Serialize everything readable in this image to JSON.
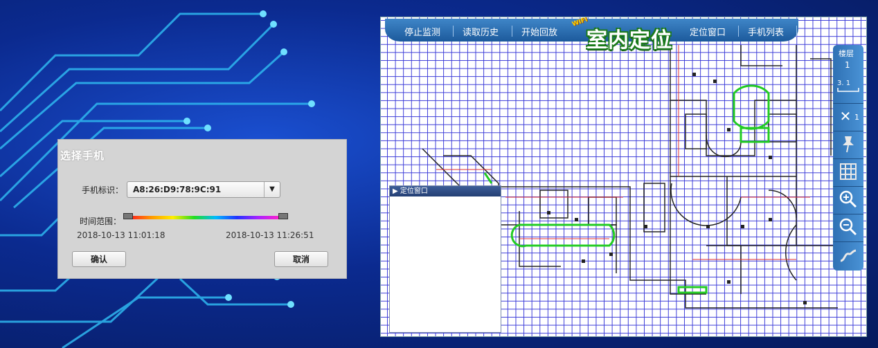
{
  "dialog": {
    "title": "选择手机",
    "phone_label": "手机标识：",
    "phone_value": "A8:26:D9:78:9C:91",
    "time_label": "时间范围：",
    "time_start": "2018-10-13 11:01:18",
    "time_end": "2018-10-13 11:26:51",
    "ok_label": "确认",
    "cancel_label": "取消"
  },
  "nav": {
    "items": [
      "停止监测",
      "读取历史",
      "开始回放",
      "定位窗口",
      "手机列表"
    ],
    "logo_text": "室内定位",
    "logo_badge": "WIFI"
  },
  "locate_window": {
    "title": "▶ 定位窗口"
  },
  "toolbar": {
    "floor_label": "楼层",
    "floor_value": "1",
    "scale_label": "3. 1",
    "close_count": "1",
    "tools": [
      "close-icon",
      "pin-icon",
      "grid-icon",
      "zoom-in-icon",
      "zoom-out-icon",
      "path-icon"
    ]
  },
  "colors": {
    "grid": "#3a3ad8",
    "nav_bar": "#2a6db0",
    "toolbar": "#3a80c4",
    "logo_text_outline": "#1b7a1b"
  }
}
